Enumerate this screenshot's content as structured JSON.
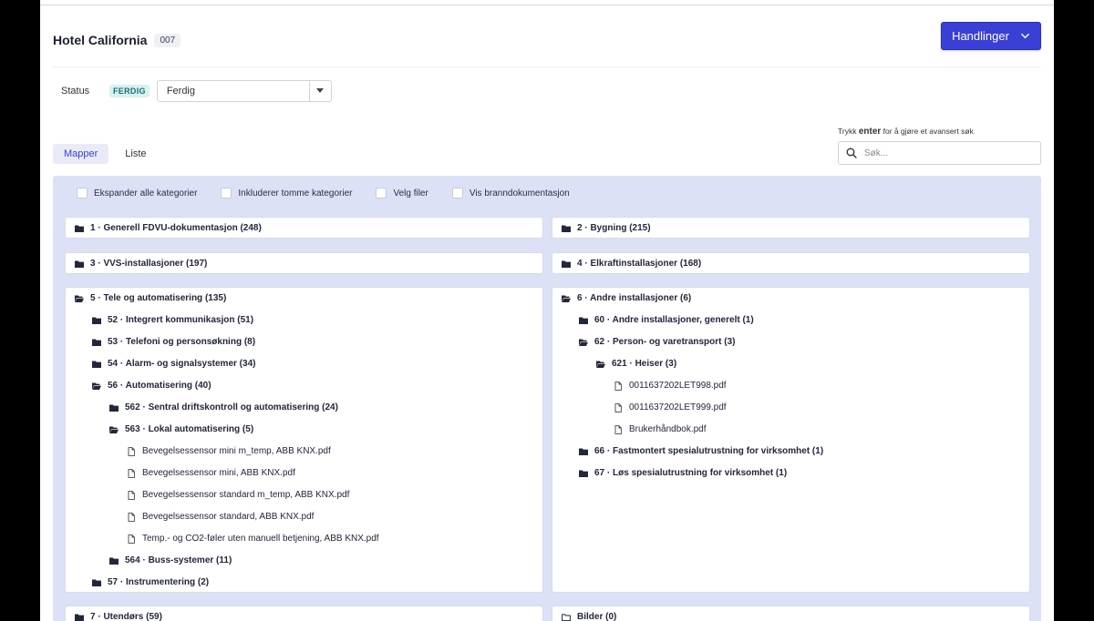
{
  "header": {
    "title": "Hotel California",
    "count": "007",
    "actions_label": "Handlinger"
  },
  "status": {
    "label": "Status",
    "badge": "FERDIG",
    "select_value": "Ferdig"
  },
  "tabs": [
    {
      "label": "Mapper",
      "active": true
    },
    {
      "label": "Liste",
      "active": false
    }
  ],
  "search": {
    "hint_prefix": "Trykk",
    "hint_key": "enter",
    "hint_suffix": "for å gjøre et avansert søk",
    "placeholder": "Søk..."
  },
  "options": [
    {
      "label": "Ekspander alle kategorier"
    },
    {
      "label": "Inkluderer tomme kategorier"
    },
    {
      "label": "Velg filer"
    },
    {
      "label": "Vis branndokumentasjon"
    }
  ],
  "cards": {
    "c1": {
      "label": "1 · Generell FDVU-dokumentasjon (248)"
    },
    "c2": {
      "label": "2 · Bygning (215)"
    },
    "c3": {
      "label": "3 · VVS-installasjoner (197)"
    },
    "c4": {
      "label": "4 · Elkraftinstallasjoner (168)"
    },
    "c5": {
      "label": "5 · Tele og automatisering (135)",
      "items": [
        {
          "label": "52 · Integrert kommunikasjon (51)",
          "icon": "folder-icon",
          "level": 1
        },
        {
          "label": "53 · Telefoni og personsøkning (8)",
          "icon": "folder-icon",
          "level": 1
        },
        {
          "label": "54 · Alarm- og signalsystemer (34)",
          "icon": "folder-icon",
          "level": 1
        },
        {
          "label": "56 · Automatisering (40)",
          "icon": "folder-open-icon",
          "level": 1
        },
        {
          "label": "562 · Sentral driftskontroll og automatisering (24)",
          "icon": "folder-icon",
          "level": 2
        },
        {
          "label": "563 · Lokal automatisering (5)",
          "icon": "folder-open-icon",
          "level": 2
        },
        {
          "label": "Bevegelsessensor mini m_temp, ABB KNX.pdf",
          "icon": "file-icon",
          "level": 3
        },
        {
          "label": "Bevegelsessensor mini, ABB KNX.pdf",
          "icon": "file-icon",
          "level": 3
        },
        {
          "label": "Bevegelsessensor standard m_temp, ABB KNX.pdf",
          "icon": "file-icon",
          "level": 3
        },
        {
          "label": "Bevegelsessensor standard, ABB KNX.pdf",
          "icon": "file-icon",
          "level": 3
        },
        {
          "label": "Temp.- og CO2-føler uten manuell betjening, ABB KNX.pdf",
          "icon": "file-icon",
          "level": 3
        },
        {
          "label": "564 · Buss-systemer (11)",
          "icon": "folder-icon",
          "level": 2
        },
        {
          "label": "57 · Instrumentering (2)",
          "icon": "folder-icon",
          "level": 1
        }
      ]
    },
    "c6": {
      "label": "6 · Andre installasjoner (6)",
      "items": [
        {
          "label": "60 · Andre installasjoner, generelt (1)",
          "icon": "folder-icon",
          "level": 1
        },
        {
          "label": "62 · Person- og varetransport (3)",
          "icon": "folder-open-icon",
          "level": 1
        },
        {
          "label": "621 · Heiser (3)",
          "icon": "folder-open-icon",
          "level": 2
        },
        {
          "label": "0011637202LET998.pdf",
          "icon": "file-icon",
          "level": 3
        },
        {
          "label": "0011637202LET999.pdf",
          "icon": "file-icon",
          "level": 3
        },
        {
          "label": "Brukerhåndbok.pdf",
          "icon": "file-icon",
          "level": 3
        },
        {
          "label": "66 · Fastmontert spesialutrustning for virksomhet (1)",
          "icon": "folder-icon",
          "level": 1
        },
        {
          "label": "67 · Løs spesialutrustning for virksomhet (1)",
          "icon": "folder-icon",
          "level": 1
        }
      ]
    },
    "c7": {
      "label": "7 · Utendørs (59)"
    },
    "c8": {
      "label": "Bilder (0)"
    }
  }
}
